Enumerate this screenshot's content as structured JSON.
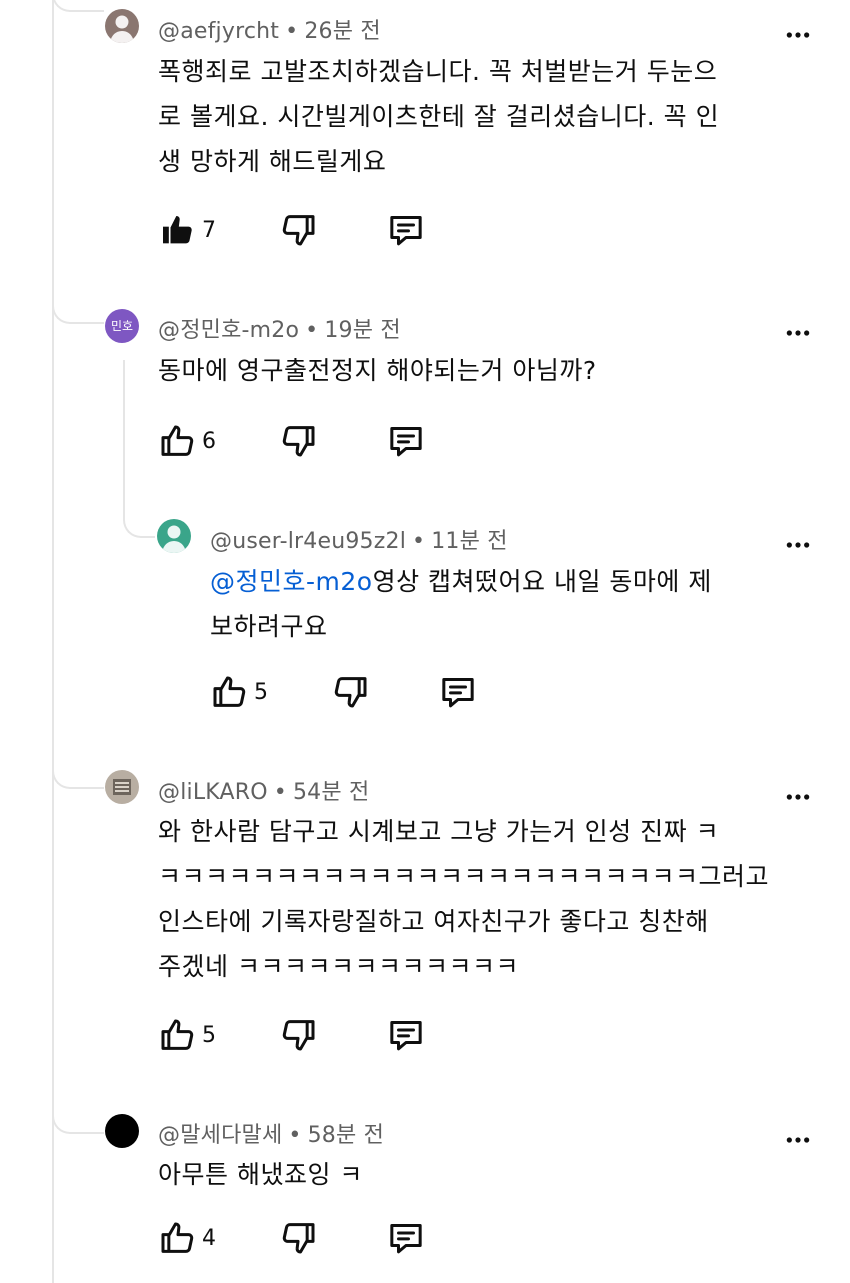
{
  "comments": [
    {
      "author": "@aefjyrcht",
      "time": "26분 전",
      "lines": [
        "폭행죄로 고발조치하겠습니다. 꼭 처벌받는거 두눈으",
        "로 볼게요. 시간빌게이츠한테 잘 걸리셨습니다. 꼭 인",
        "생 망하게 해드릴게요"
      ],
      "likes": "7",
      "avatar_color": "#8a7670"
    },
    {
      "author": "@정민호-m2o",
      "time": "19분 전",
      "lines": [
        "동마에 영구출전정지 해야되는거 아님까?"
      ],
      "likes": "6",
      "avatar_text": "민호",
      "avatar_color": "#7e57c2"
    },
    {
      "author": "@user-lr4eu95z2l",
      "time": "11분 전",
      "mention": "@정민호-m2o",
      "line1_rest": "영상 캡쳐떴어요 내일 동마에 제",
      "line2": "보하려구요",
      "likes": "5",
      "avatar_color": "#3aa58a"
    },
    {
      "author": "@liLKARO",
      "time": "54분 전",
      "lines": [
        "와 한사람 담구고 시계보고 그냥 가는거 인성 진짜 ㅋ",
        "ㅋㅋㅋㅋㅋㅋㅋㅋㅋㅋㅋㅋㅋㅋㅋㅋㅋㅋㅋㅋㅋㅋㅋ그러고",
        "인스타에 기록자랑질하고 여자친구가 좋다고 칭찬해",
        "주겠네 ㅋㅋㅋㅋㅋㅋㅋㅋㅋㅋㅋㅋ"
      ],
      "likes": "5",
      "avatar_color": "#b8aea2"
    },
    {
      "author": "@말세다말세",
      "time": "58분 전",
      "lines": [
        "아무튼 해냈죠잉 ㅋ"
      ],
      "likes": "4",
      "avatar_color": "#000000"
    }
  ]
}
